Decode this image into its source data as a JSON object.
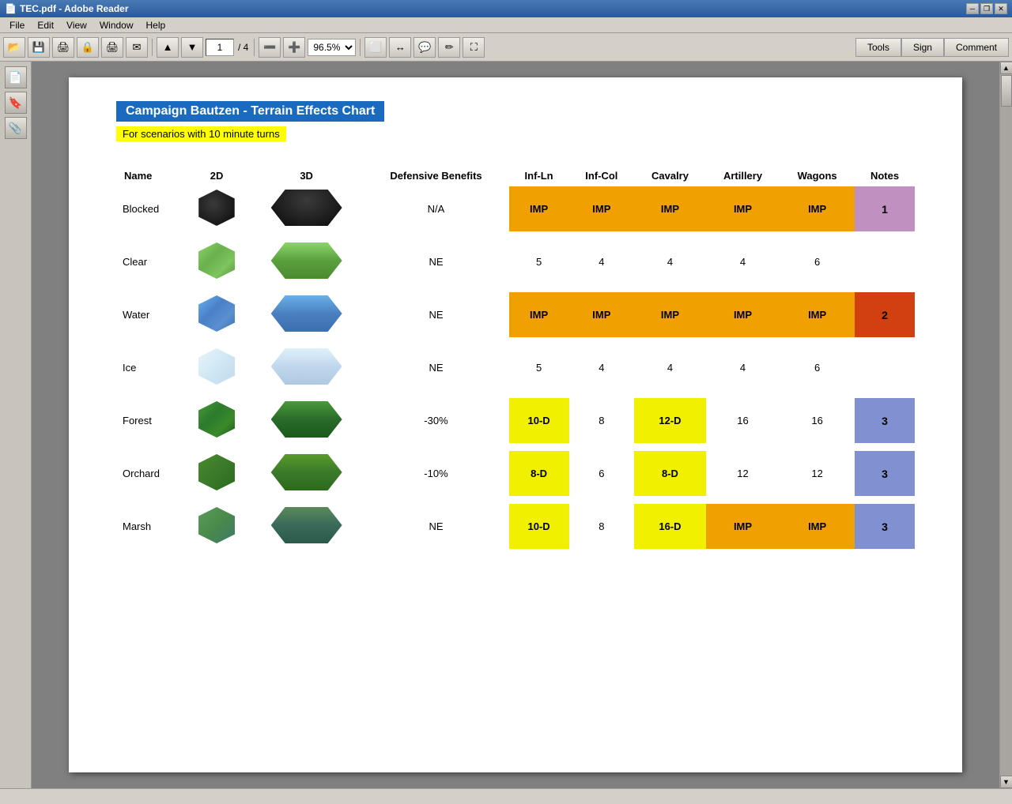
{
  "window": {
    "title": "TEC.pdf - Adobe Reader",
    "minimize": "─",
    "restore": "❒",
    "close": "✕"
  },
  "menu": {
    "items": [
      "File",
      "Edit",
      "View",
      "Window",
      "Help"
    ]
  },
  "toolbar": {
    "page_input": "1",
    "page_total": "/ 4",
    "zoom_value": "96.5%",
    "tools_btn": "Tools",
    "sign_btn": "Sign",
    "comment_btn": "Comment"
  },
  "doc": {
    "title": "Campaign Bautzen - Terrain Effects Chart",
    "subtitle": "For scenarios with 10 minute turns",
    "columns": [
      "Name",
      "2D",
      "3D",
      "Defensive Benefits",
      "Inf-Ln",
      "Inf-Col",
      "Cavalry",
      "Artillery",
      "Wagons",
      "Notes"
    ],
    "rows": [
      {
        "name": "Blocked",
        "hex2d": "blocked-2d",
        "hex3d": "blocked-3d",
        "def_benefit": "N/A",
        "inf_ln": "IMP",
        "inf_ln_color": "orange",
        "inf_col": "IMP",
        "inf_col_color": "orange",
        "cavalry": "IMP",
        "cavalry_color": "orange",
        "artillery": "IMP",
        "artillery_color": "orange",
        "wagons": "IMP",
        "wagons_color": "orange",
        "notes": "1",
        "notes_color": "purple"
      },
      {
        "name": "Clear",
        "hex2d": "clear-2d",
        "hex3d": "clear-3d",
        "def_benefit": "NE",
        "inf_ln": "5",
        "inf_ln_color": "none",
        "inf_col": "4",
        "inf_col_color": "none",
        "cavalry": "4",
        "cavalry_color": "none",
        "artillery": "4",
        "artillery_color": "none",
        "wagons": "6",
        "wagons_color": "none",
        "notes": "",
        "notes_color": "none"
      },
      {
        "name": "Water",
        "hex2d": "water-2d",
        "hex3d": "water-3d",
        "def_benefit": "NE",
        "inf_ln": "IMP",
        "inf_ln_color": "orange",
        "inf_col": "IMP",
        "inf_col_color": "orange",
        "cavalry": "IMP",
        "cavalry_color": "orange",
        "artillery": "IMP",
        "artillery_color": "orange",
        "wagons": "IMP",
        "wagons_color": "orange",
        "notes": "2",
        "notes_color": "red-org"
      },
      {
        "name": "Ice",
        "hex2d": "ice-2d",
        "hex3d": "ice-3d",
        "def_benefit": "NE",
        "inf_ln": "5",
        "inf_ln_color": "none",
        "inf_col": "4",
        "inf_col_color": "none",
        "cavalry": "4",
        "cavalry_color": "none",
        "artillery": "4",
        "artillery_color": "none",
        "wagons": "6",
        "wagons_color": "none",
        "notes": "",
        "notes_color": "none"
      },
      {
        "name": "Forest",
        "hex2d": "forest-2d",
        "hex3d": "forest-3d",
        "def_benefit": "-30%",
        "inf_ln": "10-D",
        "inf_ln_color": "yellow",
        "inf_col": "8",
        "inf_col_color": "none",
        "cavalry": "12-D",
        "cavalry_color": "yellow",
        "artillery": "16",
        "artillery_color": "none",
        "wagons": "16",
        "wagons_color": "none",
        "notes": "3",
        "notes_color": "blue-lt"
      },
      {
        "name": "Orchard",
        "hex2d": "orchard-2d",
        "hex3d": "orchard-3d",
        "def_benefit": "-10%",
        "inf_ln": "8-D",
        "inf_ln_color": "yellow",
        "inf_col": "6",
        "inf_col_color": "none",
        "cavalry": "8-D",
        "cavalry_color": "yellow",
        "artillery": "12",
        "artillery_color": "none",
        "wagons": "12",
        "wagons_color": "none",
        "notes": "3",
        "notes_color": "blue-lt"
      },
      {
        "name": "Marsh",
        "hex2d": "marsh-2d",
        "hex3d": "marsh-3d",
        "def_benefit": "NE",
        "inf_ln": "10-D",
        "inf_ln_color": "yellow",
        "inf_col": "8",
        "inf_col_color": "none",
        "cavalry": "16-D",
        "cavalry_color": "yellow",
        "artillery": "IMP",
        "artillery_color": "orange",
        "wagons": "IMP",
        "wagons_color": "orange",
        "notes": "3",
        "notes_color": "blue-lt"
      }
    ]
  }
}
